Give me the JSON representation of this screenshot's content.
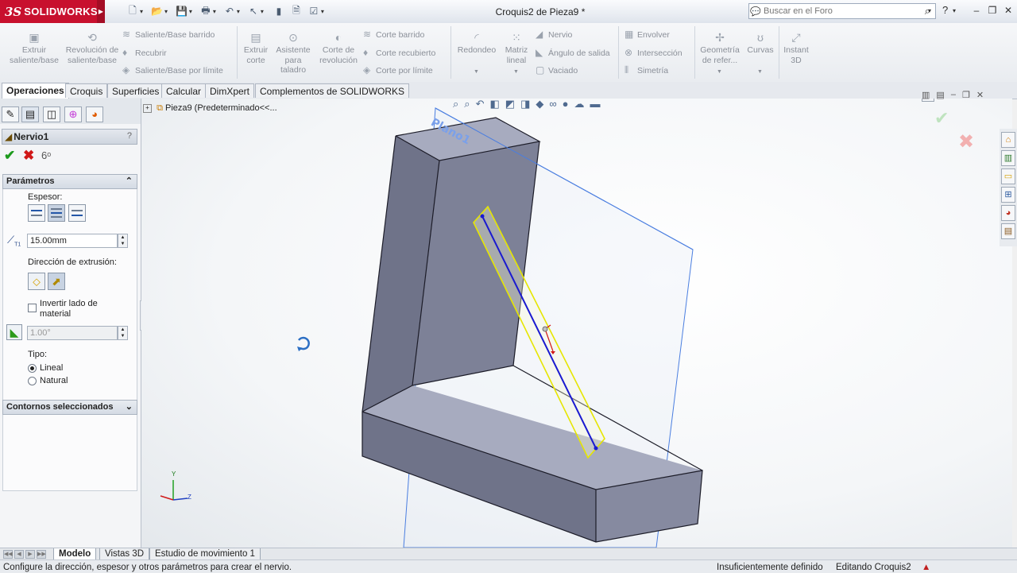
{
  "app": {
    "logo_ds": "3S",
    "logo_name": "SOLIDWORKS",
    "document_title": "Croquis2 de Pieza9 *"
  },
  "search": {
    "placeholder": "Buscar en el Foro"
  },
  "ribbon": {
    "extrude_boss": "Extruir saliente/base",
    "revolve_boss": "Revolución de saliente/base",
    "swept_boss": "Saliente/Base barrido",
    "lofted_boss": "Recubrir",
    "boundary_boss": "Saliente/Base por límite",
    "extrude_cut": "Extruir corte",
    "hole_wizard": "Asistente para taladro",
    "revolve_cut": "Corte de revolución",
    "swept_cut": "Corte barrido",
    "lofted_cut": "Corte recubierto",
    "boundary_cut": "Corte por límite",
    "fillet": "Redondeo",
    "linear_pattern": "Matriz lineal",
    "rib": "Nervio",
    "draft": "Ángulo de salida",
    "shell": "Vaciado",
    "wrap": "Envolver",
    "intersect": "Intersección",
    "mirror": "Simetría",
    "ref_geometry": "Geometría de refer...",
    "curves": "Curvas",
    "instant3d": "Instant 3D"
  },
  "tabs": [
    "Operaciones",
    "Croquis",
    "Superficies",
    "Calcular",
    "DimXpert",
    "Complementos de SOLIDWORKS"
  ],
  "panel": {
    "feature_title": "Nervio1",
    "help": "?",
    "parameters_header": "Parámetros",
    "thickness_label": "Espesor:",
    "thickness_value": "15.00mm",
    "extrusion_direction_label": "Dirección de extrusión:",
    "flip_material_label": "Invertir lado de material",
    "draft_value": "1.00°",
    "type_label": "Tipo:",
    "type_linear": "Lineal",
    "type_natural": "Natural",
    "selected_contours_header": "Contornos seleccionados"
  },
  "tree": {
    "part_label": "Pieza9  (Predeterminado<<..."
  },
  "viewport": {
    "plane_label": "Plano1",
    "axis_y": "Y",
    "axis_z": "Z"
  },
  "bottom_tabs": [
    "Modelo",
    "Vistas 3D",
    "Estudio de movimiento 1"
  ],
  "status": {
    "message": "Configure la dirección, espesor y otros parámetros para crear el nervio.",
    "sketch_state": "Insuficientemente definido",
    "editing": "Editando Croquis2"
  },
  "colors": {
    "brand": "#c8102e",
    "part_face_top": "#a7abbf",
    "part_face_side": "#7d8197",
    "sketch_line": "#1a1ad0",
    "rib_preview": "#e6e600",
    "plane_edge": "#4a7ee0"
  }
}
